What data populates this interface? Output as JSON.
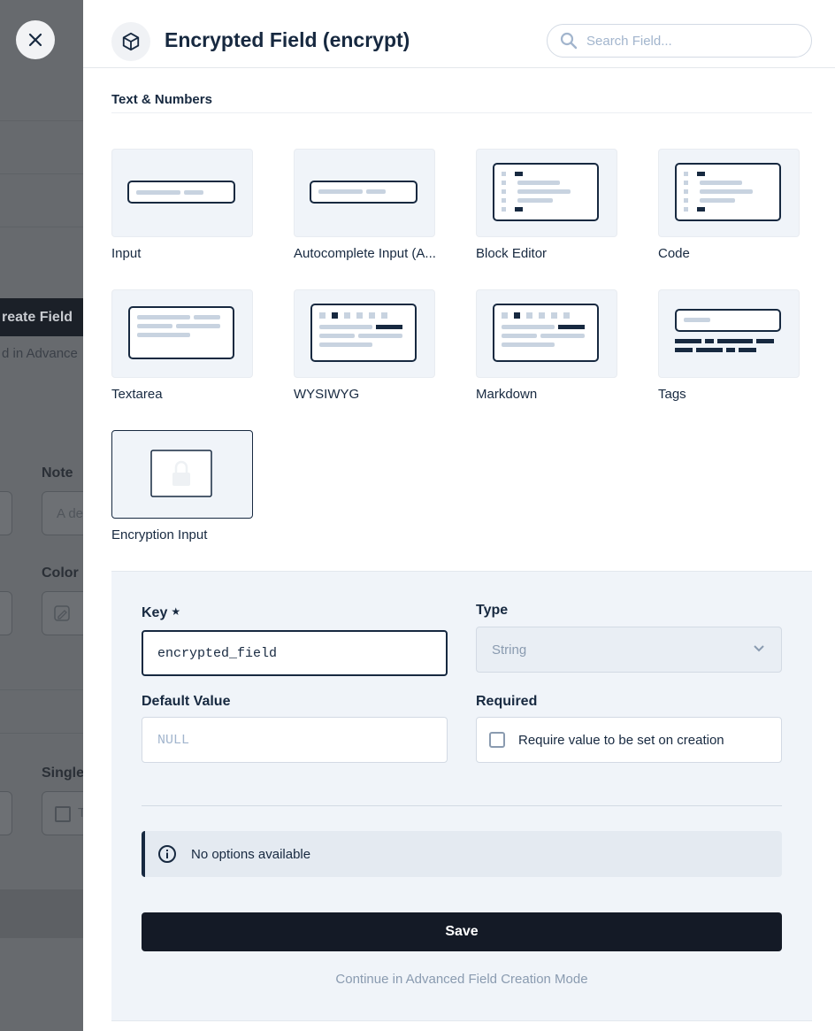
{
  "backdrop": {
    "create_field_label": "reate Field",
    "advanced_text": "d in Advance",
    "note_label": "Note",
    "note_placeholder": "A de",
    "color_label": "Color",
    "single_label": "Single",
    "single_partial": "T"
  },
  "drawer": {
    "title": "Encrypted Field (encrypt)",
    "search_placeholder": "Search Field..."
  },
  "section": {
    "title": "Text & Numbers"
  },
  "interfaces": [
    {
      "label": "Input",
      "icon": "input-preview"
    },
    {
      "label": "Autocomplete Input (A...",
      "icon": "autocomplete-preview"
    },
    {
      "label": "Block Editor",
      "icon": "block-editor-preview"
    },
    {
      "label": "Code",
      "icon": "code-preview"
    },
    {
      "label": "Textarea",
      "icon": "textarea-preview"
    },
    {
      "label": "WYSIWYG",
      "icon": "wysiwyg-preview"
    },
    {
      "label": "Markdown",
      "icon": "markdown-preview"
    },
    {
      "label": "Tags",
      "icon": "tags-preview"
    },
    {
      "label": "Encryption Input",
      "icon": "lock-preview",
      "selected": true
    }
  ],
  "form": {
    "key_label": "Key",
    "key_value": "encrypted_field",
    "type_label": "Type",
    "type_value": "String",
    "default_label": "Default Value",
    "default_placeholder": "NULL",
    "required_label": "Required",
    "required_text": "Require value to be set on creation",
    "required_checked": false
  },
  "notice": {
    "text": "No options available"
  },
  "actions": {
    "save_label": "Save",
    "advanced_label": "Continue in Advanced Field Creation Mode"
  },
  "colors": {
    "primary": "#172940",
    "button": "#141a26",
    "panel": "#f0f4f9",
    "muted": "#8a9bb0"
  }
}
